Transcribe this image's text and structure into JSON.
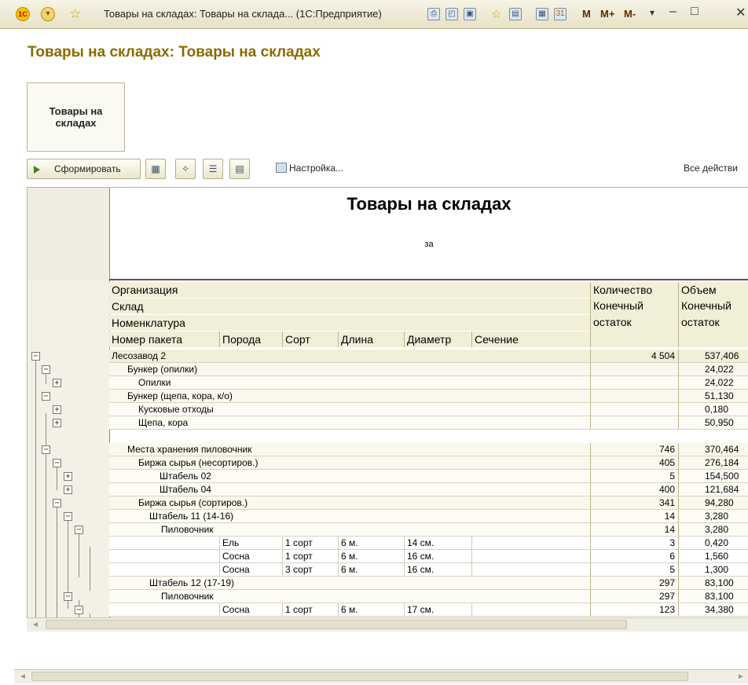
{
  "window": {
    "title": "Товары на складах: Товары на склада...  (1С:Предприятие)",
    "mem": [
      "M",
      "M+",
      "M-"
    ]
  },
  "form": {
    "title": "Товары на складах: Товары на складах",
    "panel_button": "Товары на складах"
  },
  "toolbar": {
    "generate_label": "Сформировать",
    "settings_label": "Настройка...",
    "all_actions_label": "Все действи"
  },
  "report": {
    "title": "Товары на складах",
    "subtitle": "за",
    "header": {
      "org": "Организация",
      "warehouse": "Склад",
      "nomenclature": "Номенклатура",
      "qty": "Количество",
      "volume": "Объем",
      "qty_sub": "Конечный остаток",
      "vol_sub": "Конечный остаток",
      "columns": [
        "Номер пакета",
        "Порода",
        "Сорт",
        "Длина",
        "Диаметр",
        "Сечение"
      ]
    },
    "rows": [
      {
        "label": "Лесозавод 2",
        "qty": "4 504",
        "vol": "537,406"
      },
      {
        "label": "Бункер (опилки)",
        "qty": "",
        "vol": "24,022"
      },
      {
        "label": "Опилки",
        "qty": "",
        "vol": "24,022"
      },
      {
        "label": "Бункер (щепа, кора, к/о)",
        "qty": "",
        "vol": "51,130"
      },
      {
        "label": "Кусковые отходы",
        "qty": "",
        "vol": "0,180"
      },
      {
        "label": "Щепа, кора",
        "qty": "",
        "vol": "50,950"
      },
      {
        "label": "Места хранения пиловочник",
        "qty": "746",
        "vol": "370,464"
      },
      {
        "label": "Биржа сырья (несортиров.)",
        "qty": "405",
        "vol": "276,184"
      },
      {
        "label": "Штабель 02",
        "qty": "5",
        "vol": "154,500"
      },
      {
        "label": "Штабель 04",
        "qty": "400",
        "vol": "121,684"
      },
      {
        "label": "Биржа сырья (сортиров.)",
        "qty": "341",
        "vol": "94,280"
      },
      {
        "label": "Штабель 11 (14-16)",
        "qty": "14",
        "vol": "3,280"
      },
      {
        "label": "Пиловочник",
        "qty": "14",
        "vol": "3,280"
      },
      {
        "label": "",
        "species": "Ель",
        "grade": "1 сорт",
        "length": "6 м.",
        "diameter": "14 см.",
        "qty": "3",
        "vol": "0,420"
      },
      {
        "label": "",
        "species": "Сосна",
        "grade": "1 сорт",
        "length": "6 м.",
        "diameter": "16 см.",
        "qty": "6",
        "vol": "1,560"
      },
      {
        "label": "",
        "species": "Сосна",
        "grade": "3 сорт",
        "length": "6 м.",
        "diameter": "16 см.",
        "qty": "5",
        "vol": "1,300"
      },
      {
        "label": "Штабель 12 (17-19)",
        "qty": "297",
        "vol": "83,100"
      },
      {
        "label": "Пиловочник",
        "qty": "297",
        "vol": "83,100"
      },
      {
        "label": "",
        "species": "Сосна",
        "grade": "1 сорт",
        "length": "6 м.",
        "diameter": "17 см.",
        "qty": "123",
        "vol": "34,380"
      }
    ]
  }
}
